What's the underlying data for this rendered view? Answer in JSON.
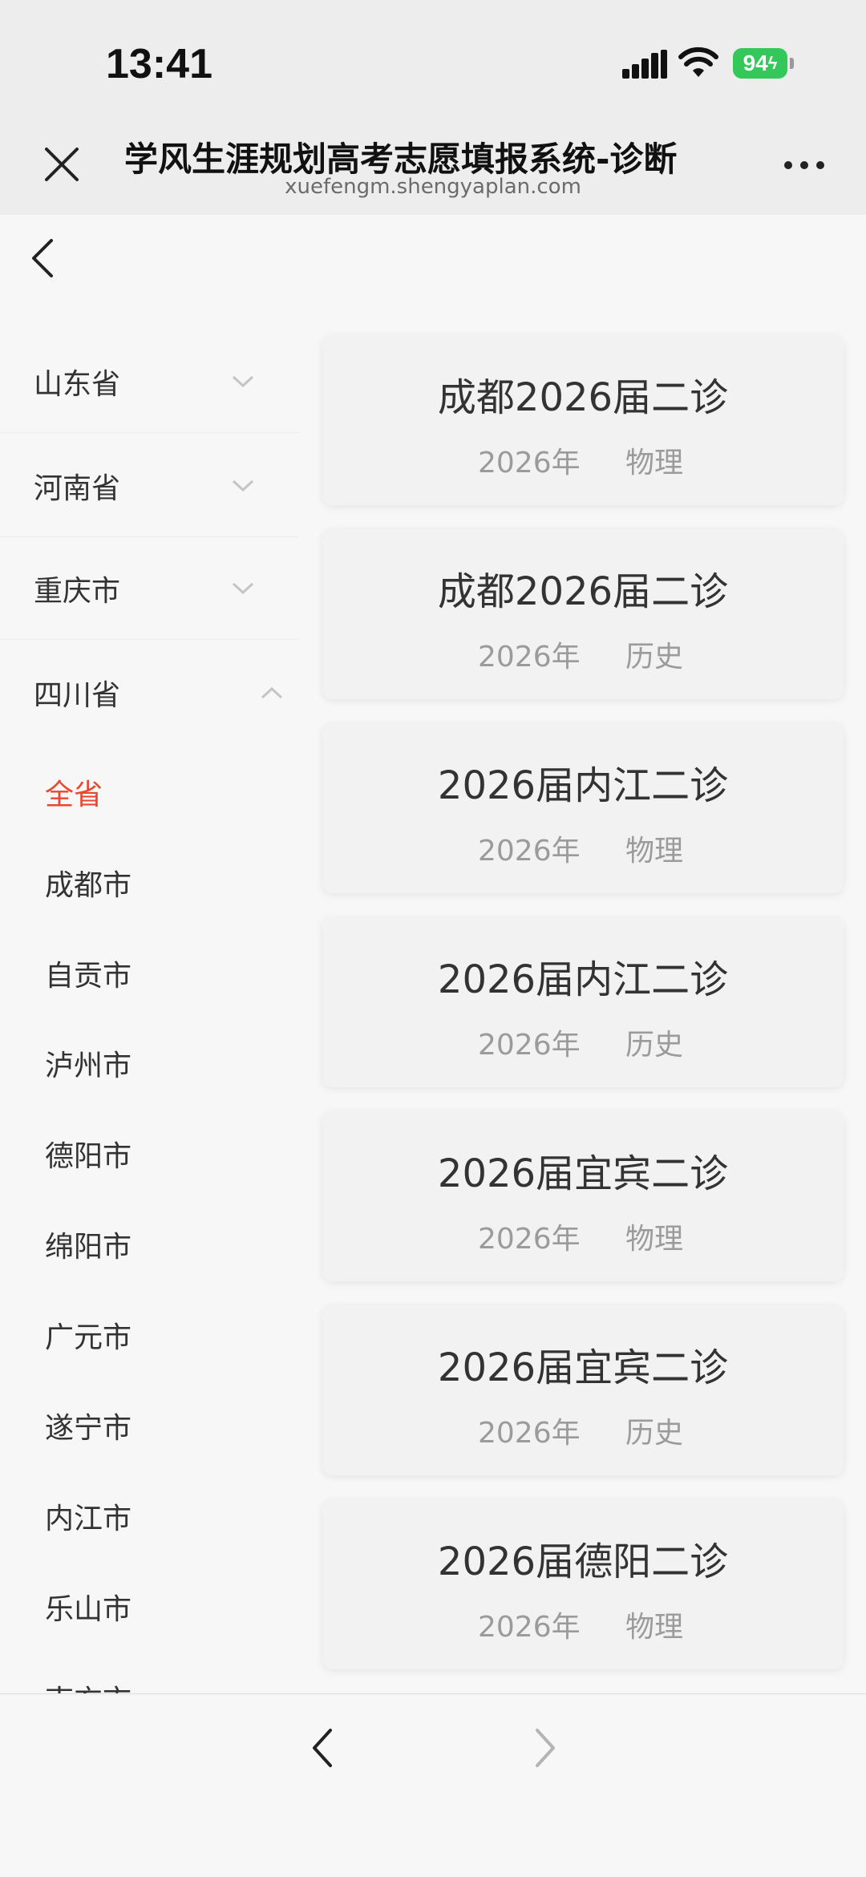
{
  "status_bar": {
    "time": "13:41",
    "battery": "94"
  },
  "header": {
    "title": "学风生涯规划高考志愿填报系统-诊断",
    "url": "xuefengm.shengyaplan.com"
  },
  "sidebar": {
    "provinces": [
      {
        "label": "山东省",
        "expanded": false
      },
      {
        "label": "河南省",
        "expanded": false
      },
      {
        "label": "重庆市",
        "expanded": false
      },
      {
        "label": "四川省",
        "expanded": true
      }
    ],
    "cities": [
      {
        "label": "全省",
        "active": true
      },
      {
        "label": "成都市"
      },
      {
        "label": "自贡市"
      },
      {
        "label": "泸州市"
      },
      {
        "label": "德阳市"
      },
      {
        "label": "绵阳市"
      },
      {
        "label": "广元市"
      },
      {
        "label": "遂宁市"
      },
      {
        "label": "内江市"
      },
      {
        "label": "乐山市"
      },
      {
        "label": "南充市"
      }
    ]
  },
  "cards": [
    {
      "title": "成都2026届二诊",
      "year": "2026年",
      "subject": "物理"
    },
    {
      "title": "成都2026届二诊",
      "year": "2026年",
      "subject": "历史"
    },
    {
      "title": "2026届内江二诊",
      "year": "2026年",
      "subject": "物理"
    },
    {
      "title": "2026届内江二诊",
      "year": "2026年",
      "subject": "历史"
    },
    {
      "title": "2026届宜宾二诊",
      "year": "2026年",
      "subject": "物理"
    },
    {
      "title": "2026届宜宾二诊",
      "year": "2026年",
      "subject": "历史"
    },
    {
      "title": "2026届德阳二诊",
      "year": "2026年",
      "subject": "物理"
    }
  ],
  "colors": {
    "accent": "#e8492e",
    "battery": "#34c759"
  }
}
